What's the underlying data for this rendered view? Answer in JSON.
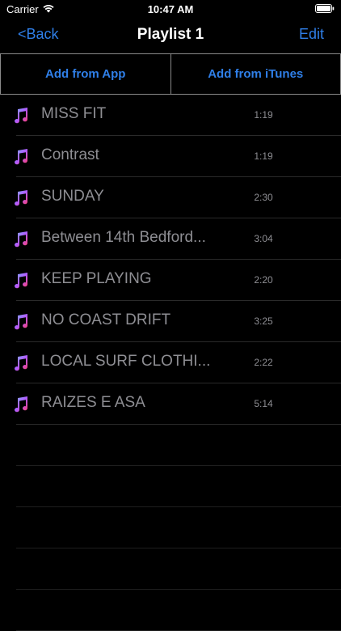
{
  "status": {
    "carrier": "Carrier",
    "time": "10:47 AM"
  },
  "nav": {
    "back_label": "<Back",
    "title": "Playlist 1",
    "edit_label": "Edit"
  },
  "actions": {
    "add_from_app": "Add from App",
    "add_from_itunes": "Add from iTunes"
  },
  "colors": {
    "accent": "#2f7fe8",
    "text_secondary": "#8e8e93",
    "background": "#000000"
  },
  "tracks": [
    {
      "title": "MISS FIT",
      "duration": "1:19",
      "icon": "music-note-icon"
    },
    {
      "title": "Contrast",
      "duration": "1:19",
      "icon": "music-note-icon"
    },
    {
      "title": "SUNDAY",
      "duration": "2:30",
      "icon": "music-note-icon"
    },
    {
      "title": "Between 14th Bedford...",
      "duration": "3:04",
      "icon": "music-note-icon"
    },
    {
      "title": "KEEP PLAYING",
      "duration": "2:20",
      "icon": "music-note-icon"
    },
    {
      "title": "NO COAST DRIFT",
      "duration": "3:25",
      "icon": "music-note-icon"
    },
    {
      "title": "LOCAL SURF CLOTHI...",
      "duration": "2:22",
      "icon": "music-note-icon"
    },
    {
      "title": "RAIZES E ASA",
      "duration": "5:14",
      "icon": "music-note-icon"
    }
  ]
}
